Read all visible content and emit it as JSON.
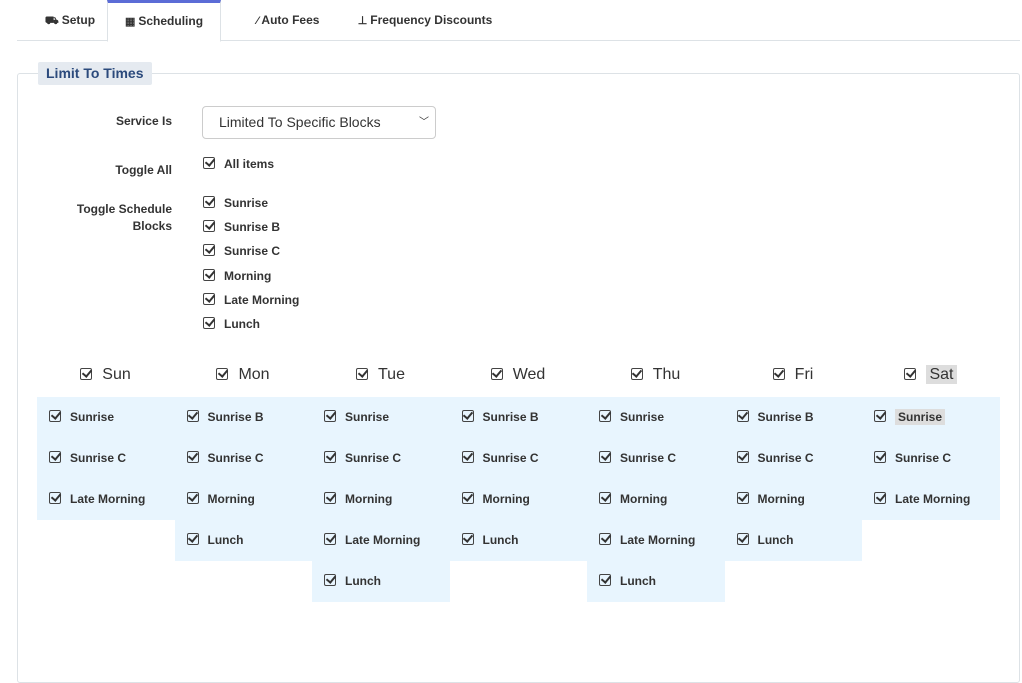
{
  "tabs": [
    {
      "label": "Setup",
      "icon": "road-icon"
    },
    {
      "label": "Scheduling",
      "icon": "calendar-icon",
      "active": true
    },
    {
      "label": "Auto Fees",
      "icon": "magic-wand-icon"
    },
    {
      "label": "Frequency Discounts",
      "icon": "sitemap-icon"
    }
  ],
  "legend": "Limit To Times",
  "service": {
    "label": "Service Is",
    "value": "Limited To Specific Blocks"
  },
  "toggle_all": {
    "label": "Toggle All",
    "item": "All items",
    "checked": true
  },
  "toggle_blocks": {
    "label": "Toggle Schedule Blocks",
    "items": [
      "Sunrise",
      "Sunrise B",
      "Sunrise C",
      "Morning",
      "Late Morning",
      "Lunch"
    ]
  },
  "days": [
    {
      "name": "Sun",
      "checked": true,
      "blocks": [
        "Sunrise",
        "Sunrise C",
        "Late Morning"
      ]
    },
    {
      "name": "Mon",
      "checked": true,
      "blocks": [
        "Sunrise B",
        "Sunrise C",
        "Morning",
        "Lunch"
      ]
    },
    {
      "name": "Tue",
      "checked": true,
      "blocks": [
        "Sunrise",
        "Sunrise C",
        "Morning",
        "Late Morning",
        "Lunch"
      ]
    },
    {
      "name": "Wed",
      "checked": true,
      "blocks": [
        "Sunrise B",
        "Sunrise C",
        "Morning",
        "Lunch"
      ]
    },
    {
      "name": "Thu",
      "checked": true,
      "blocks": [
        "Sunrise",
        "Sunrise C",
        "Morning",
        "Late Morning",
        "Lunch"
      ]
    },
    {
      "name": "Fri",
      "checked": true,
      "blocks": [
        "Sunrise B",
        "Sunrise C",
        "Morning",
        "Lunch"
      ]
    },
    {
      "name": "Sat",
      "checked": true,
      "blocks": [
        "Sunrise",
        "Sunrise C",
        "Late Morning"
      ]
    }
  ],
  "colors": {
    "active_tab": "#5b6cd6",
    "legend_text": "#2b4a7c",
    "column_bg": "#e8f5fe",
    "highlight": "#dddddd"
  }
}
